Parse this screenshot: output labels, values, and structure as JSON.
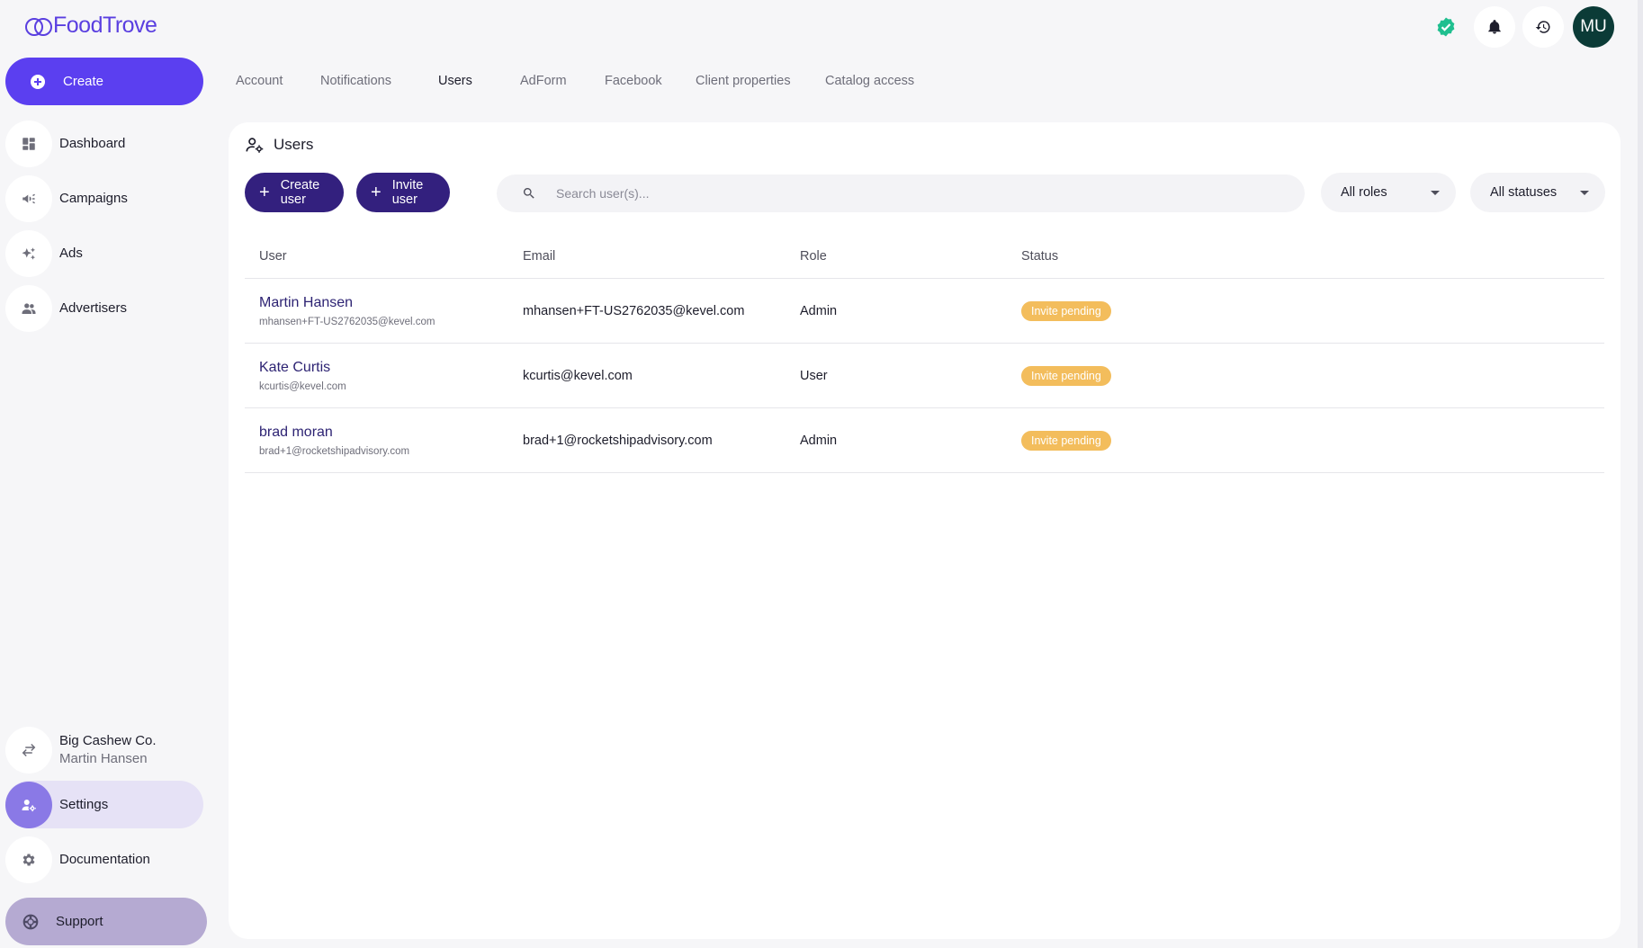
{
  "brand": {
    "name": "FoodTrove"
  },
  "sidebar": {
    "create_label": "Create",
    "items": [
      {
        "label": "Dashboard",
        "icon": "dashboard-icon"
      },
      {
        "label": "Campaigns",
        "icon": "megaphone-icon"
      },
      {
        "label": "Ads",
        "icon": "sparkle-icon"
      },
      {
        "label": "Advertisers",
        "icon": "people-icon"
      }
    ],
    "account": {
      "company": "Big Cashew Co.",
      "user": "Martin Hansen"
    },
    "settings_label": "Settings",
    "documentation_label": "Documentation",
    "support_label": "Support"
  },
  "topbar": {
    "avatar_initials": "MU"
  },
  "tabs": [
    {
      "label": "Account"
    },
    {
      "label": "Notifications"
    },
    {
      "label": "Users",
      "active": true
    },
    {
      "label": "AdForm"
    },
    {
      "label": "Facebook"
    },
    {
      "label": "Client properties"
    },
    {
      "label": "Catalog access"
    }
  ],
  "users_page": {
    "title": "Users",
    "create_user_label": "Create user",
    "invite_user_label": "Invite user",
    "search_placeholder": "Search user(s)...",
    "roles_filter": "All roles",
    "status_filter": "All statuses",
    "columns": {
      "user": "User",
      "email": "Email",
      "role": "Role",
      "status": "Status"
    },
    "rows": [
      {
        "name": "Martin Hansen",
        "sub": "mhansen+FT-US2762035@kevel.com",
        "email": "mhansen+FT-US2762035@kevel.com",
        "role": "Admin",
        "status": "Invite pending"
      },
      {
        "name": "Kate Curtis",
        "sub": "kcurtis@kevel.com",
        "email": "kcurtis@kevel.com",
        "role": "User",
        "status": "Invite pending"
      },
      {
        "name": "brad moran",
        "sub": "brad+1@rocketshipadvisory.com",
        "email": "brad+1@rocketshipadvisory.com",
        "role": "Admin",
        "status": "Invite pending"
      }
    ]
  },
  "colors": {
    "primary": "#5b3ff0",
    "dark_button": "#33207e",
    "badge": "#f3bd5c",
    "avatar": "#0b3b37",
    "verified": "#1fbf8f"
  }
}
